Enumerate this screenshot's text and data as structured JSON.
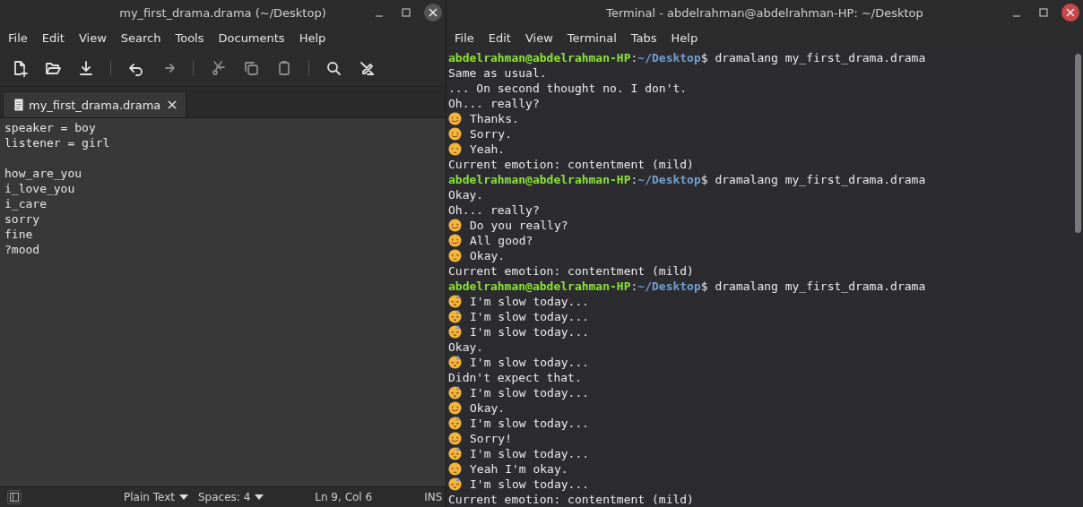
{
  "editor_window": {
    "title": "my_first_drama.drama (~/Desktop)",
    "active": false,
    "menu": [
      "File",
      "Edit",
      "View",
      "Search",
      "Tools",
      "Documents",
      "Help"
    ],
    "toolbar": [
      {
        "kind": "new",
        "disabled": false
      },
      {
        "kind": "open",
        "disabled": false
      },
      {
        "kind": "save",
        "disabled": false
      },
      {
        "kind": "sep"
      },
      {
        "kind": "undo",
        "disabled": false
      },
      {
        "kind": "redo",
        "disabled": true
      },
      {
        "kind": "sep"
      },
      {
        "kind": "cut",
        "disabled": true
      },
      {
        "kind": "copy",
        "disabled": true
      },
      {
        "kind": "paste",
        "disabled": true
      },
      {
        "kind": "sep"
      },
      {
        "kind": "search",
        "disabled": false
      },
      {
        "kind": "tools",
        "disabled": false
      }
    ],
    "tabs": [
      {
        "label": "my_first_drama.drama",
        "selected": true
      }
    ],
    "text": "speaker = boy\nlistener = girl\n\nhow_are_you\ni_love_you\ni_care\nsorry\nfine\n?mood",
    "status_bar": {
      "language": "Plain Text",
      "indent": "Spaces: 4",
      "position": "Ln 9, Col 6",
      "mode": "INS"
    }
  },
  "terminal_window": {
    "title": "Terminal - abdelrahman@abdelrahman-HP: ~/Desktop",
    "active": true,
    "menu": [
      "File",
      "Edit",
      "View",
      "Terminal",
      "Tabs",
      "Help"
    ],
    "lines": [
      {
        "kind": "prompt",
        "user": "abdelrahman@abdelrahman-HP",
        "separator": ":",
        "path": "~/Desktop",
        "command": "$ dramalang my_first_drama.drama"
      },
      {
        "kind": "text",
        "text": "Same as usual."
      },
      {
        "kind": "text",
        "text": "... On second thought no. I don't."
      },
      {
        "kind": "text",
        "text": "Oh... really?"
      },
      {
        "kind": "smile",
        "text": "Thanks."
      },
      {
        "kind": "smile",
        "text": "Sorry."
      },
      {
        "kind": "pensive",
        "text": "Yeah."
      },
      {
        "kind": "text",
        "text": "Current emotion: contentment (mild)"
      },
      {
        "kind": "prompt",
        "user": "abdelrahman@abdelrahman-HP",
        "separator": ":",
        "path": "~/Desktop",
        "command": "$ dramalang my_first_drama.drama"
      },
      {
        "kind": "text",
        "text": "Okay."
      },
      {
        "kind": "text",
        "text": "Oh... really?"
      },
      {
        "kind": "smile",
        "text": "Do you really?"
      },
      {
        "kind": "smile",
        "text": "All good?"
      },
      {
        "kind": "pensive",
        "text": "Okay."
      },
      {
        "kind": "text",
        "text": "Current emotion: contentment (mild)"
      },
      {
        "kind": "prompt",
        "user": "abdelrahman@abdelrahman-HP",
        "separator": ":",
        "path": "~/Desktop",
        "command": "$ dramalang my_first_drama.drama"
      },
      {
        "kind": "sleepy",
        "text": "I'm slow today..."
      },
      {
        "kind": "sleepy",
        "text": "I'm slow today..."
      },
      {
        "kind": "sleepy",
        "text": "I'm slow today..."
      },
      {
        "kind": "text",
        "text": "Okay."
      },
      {
        "kind": "sleepy",
        "text": "I'm slow today..."
      },
      {
        "kind": "text",
        "text": "Didn't expect that."
      },
      {
        "kind": "sleepy",
        "text": "I'm slow today..."
      },
      {
        "kind": "smile",
        "text": "Okay."
      },
      {
        "kind": "sleepy",
        "text": "I'm slow today..."
      },
      {
        "kind": "smile",
        "text": "Sorry!"
      },
      {
        "kind": "sleepy",
        "text": "I'm slow today..."
      },
      {
        "kind": "pensive",
        "text": "Yeah I'm okay."
      },
      {
        "kind": "sleepy",
        "text": "I'm slow today..."
      },
      {
        "kind": "text",
        "text": "Current emotion: contentment (mild)"
      }
    ]
  }
}
